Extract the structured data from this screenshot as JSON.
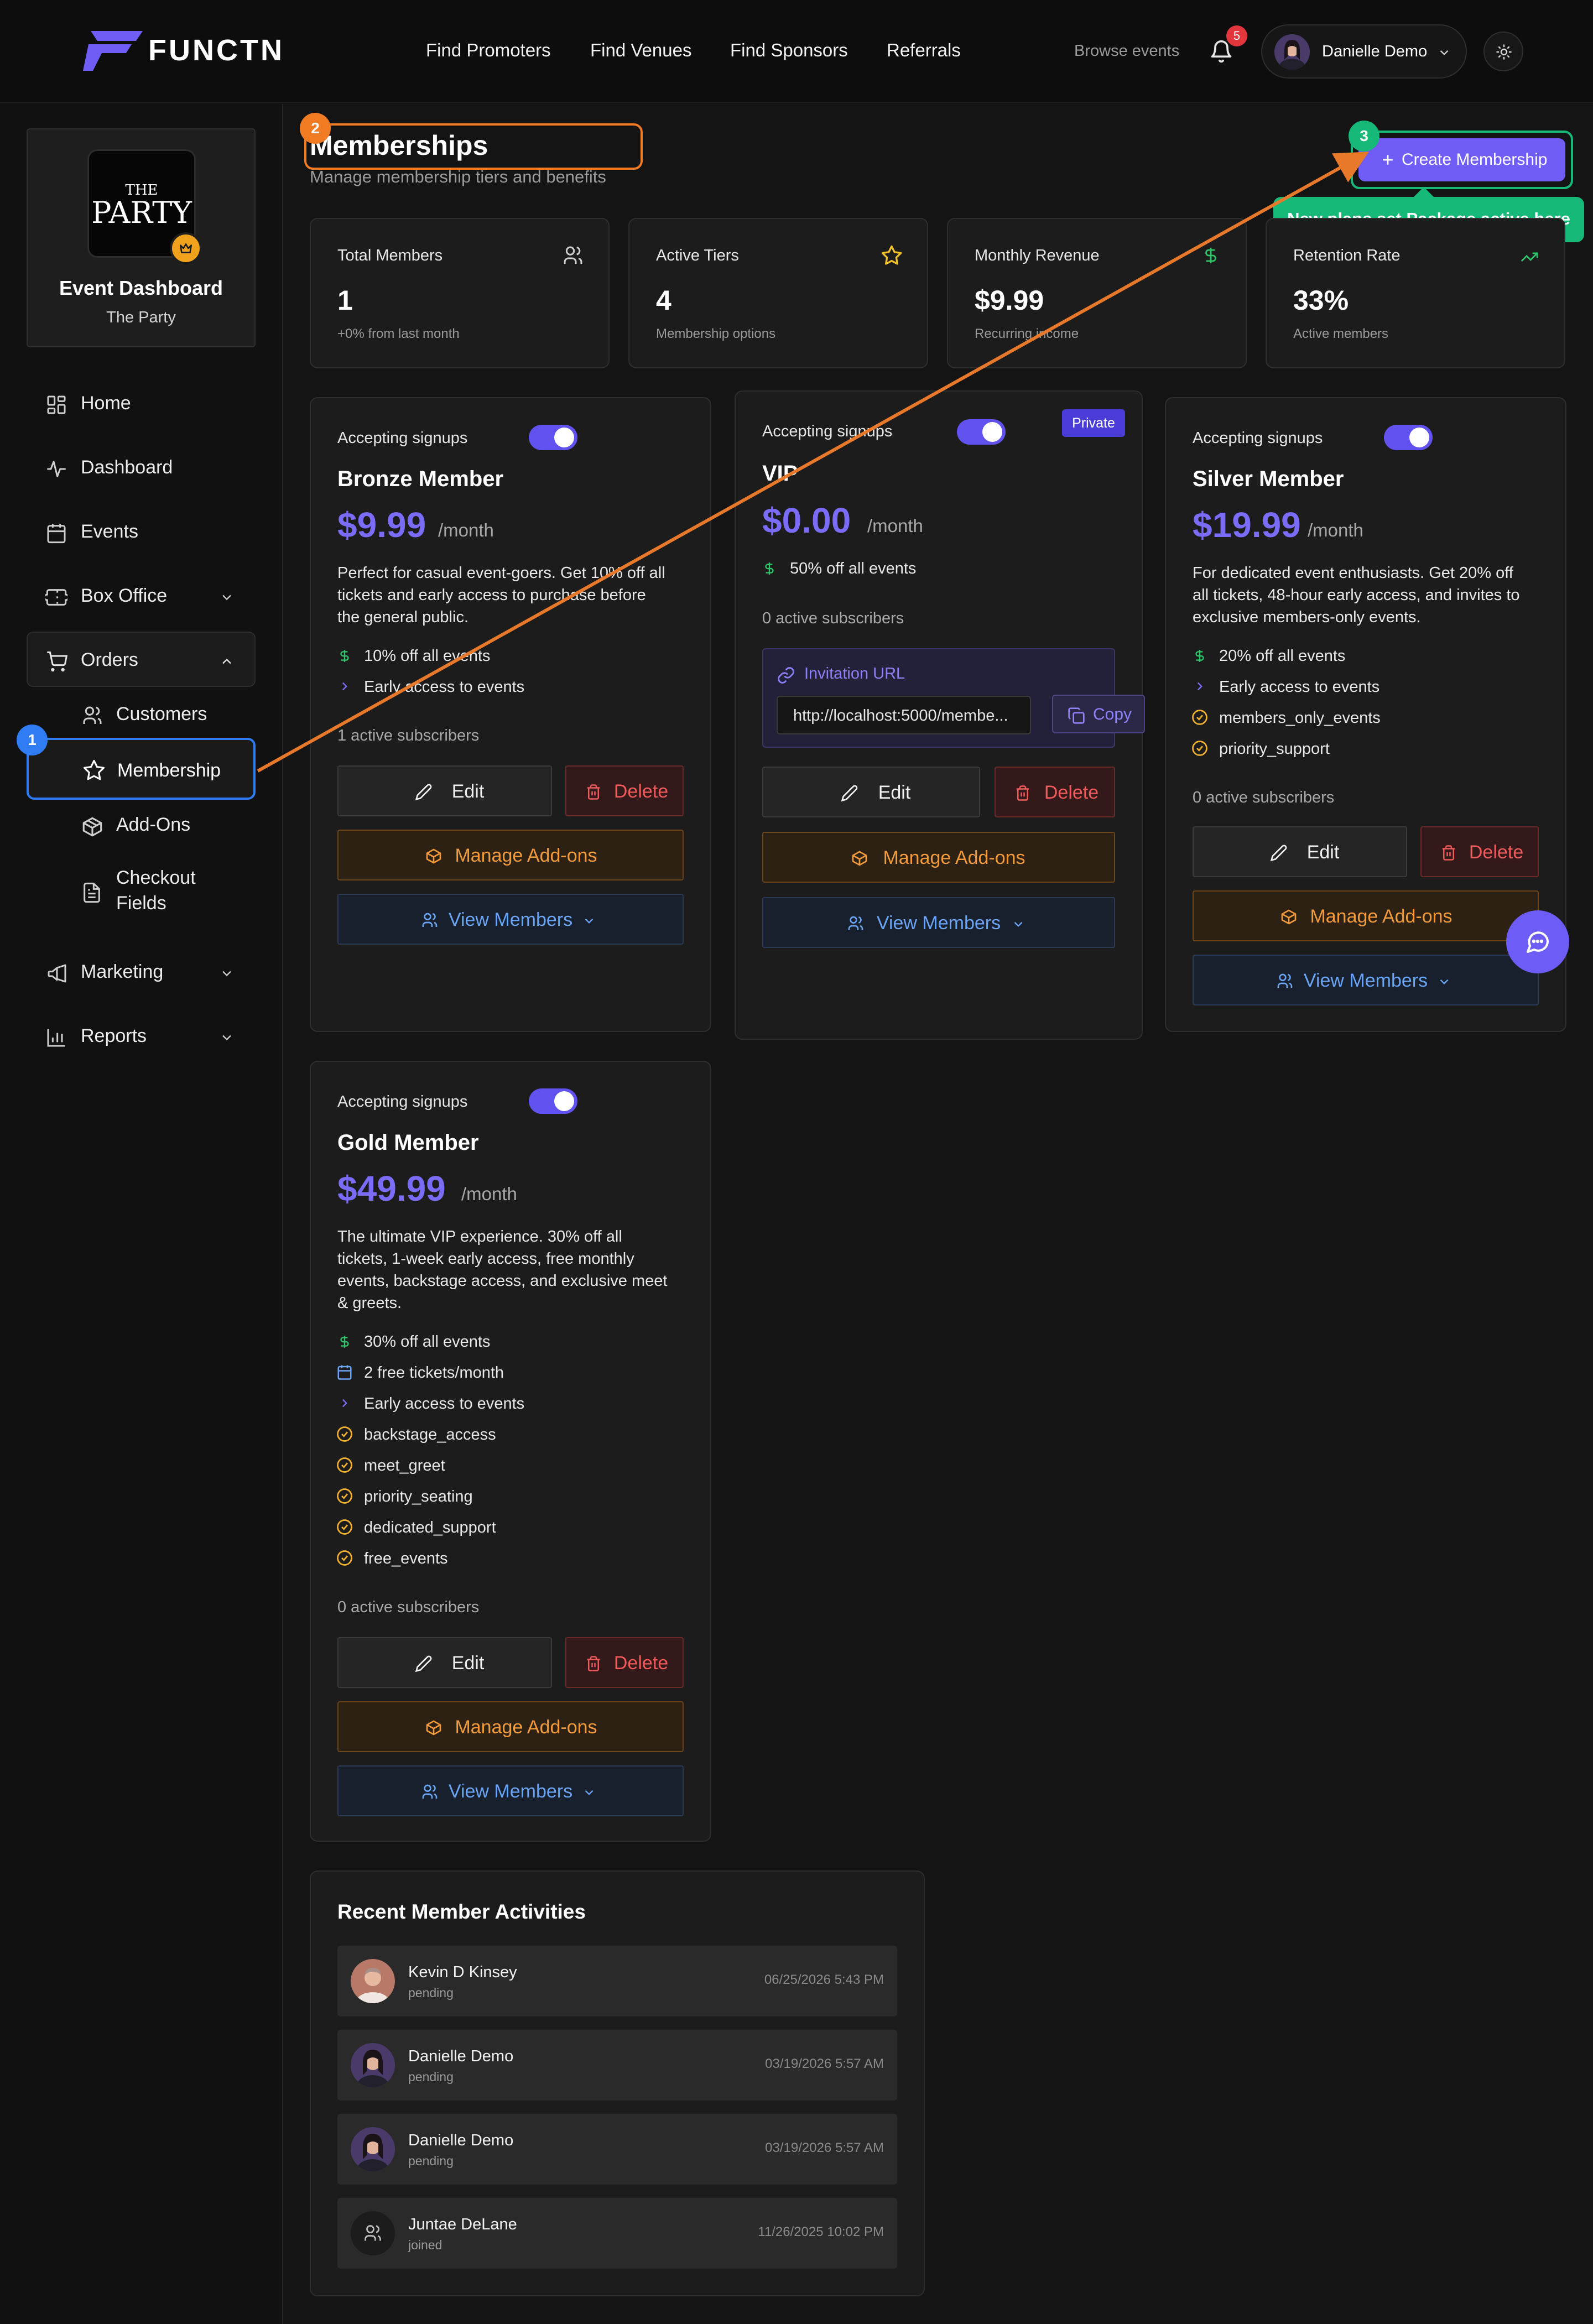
{
  "header": {
    "brand": "FUNCTN",
    "nav": [
      "Find Promoters",
      "Find Venues",
      "Find Sponsors",
      "Referrals"
    ],
    "browse": "Browse events",
    "notification_count": "5",
    "user_name": "Danielle Demo"
  },
  "sidebar": {
    "event_logo_line1": "THE",
    "event_logo_line2": "PARTY",
    "event_title": "Event Dashboard",
    "event_subtitle": "The Party",
    "items": {
      "home": "Home",
      "dashboard": "Dashboard",
      "events": "Events",
      "box_office": "Box Office",
      "orders": "Orders",
      "customers": "Customers",
      "membership": "Membership",
      "addons": "Add-Ons",
      "checkout_line1": "Checkout",
      "checkout_line2": "Fields",
      "marketing": "Marketing",
      "reports": "Reports"
    }
  },
  "annotations": {
    "step1": "1",
    "step2": "2",
    "step3": "3",
    "tooltip": "New plans set Package active here"
  },
  "page": {
    "title": "Memberships",
    "subtitle": "Manage membership tiers and benefits",
    "create_button": "Create Membership"
  },
  "stats": [
    {
      "label": "Total Members",
      "value": "1",
      "sub": "+0% from last month"
    },
    {
      "label": "Active Tiers",
      "value": "4",
      "sub": "Membership options"
    },
    {
      "label": "Monthly Revenue",
      "value": "$9.99",
      "sub": "Recurring income"
    },
    {
      "label": "Retention Rate",
      "value": "33%",
      "sub": "Active members"
    }
  ],
  "common": {
    "accepting": "Accepting signups",
    "per_month": "/month",
    "edit": "Edit",
    "delete": "Delete",
    "manage_addons": "Manage Add-ons",
    "view_members": "View Members",
    "private": "Private",
    "invitation_url": "Invitation URL",
    "copy": "Copy"
  },
  "tiers": {
    "bronze": {
      "name": "Bronze Member",
      "price": "$9.99",
      "desc": [
        "Perfect for casual event-goers. Get 10% off all",
        "tickets and early access to purchase before",
        "the general public."
      ],
      "features": [
        "10% off all events",
        "Early access to events"
      ],
      "subscribers": "1 active subscribers"
    },
    "vip": {
      "name": "VIP",
      "price": "$0.00",
      "features": [
        "50% off all events"
      ],
      "subscribers": "0 active subscribers",
      "invite_url": "http://localhost:5000/membe..."
    },
    "silver": {
      "name": "Silver Member",
      "price": "$19.99",
      "desc": [
        "For dedicated event enthusiasts. Get 20% off",
        "all tickets, 48-hour early access, and invites to",
        "exclusive members-only events."
      ],
      "features": [
        "20% off all events",
        "Early access to events",
        "members_only_events",
        "priority_support"
      ],
      "subscribers": "0 active subscribers"
    },
    "gold": {
      "name": "Gold Member",
      "price": "$49.99",
      "desc": [
        "The ultimate VIP experience. 30% off all",
        "tickets, 1-week early access, free monthly",
        "events, backstage access, and exclusive meet",
        "& greets."
      ],
      "features": [
        "30% off all events",
        "2 free tickets/month",
        "Early access to events",
        "backstage_access",
        "meet_greet",
        "priority_seating",
        "dedicated_support",
        "free_events"
      ],
      "subscribers": "0 active subscribers"
    }
  },
  "activities": {
    "title": "Recent Member Activities",
    "rows": [
      {
        "name": "Kevin D Kinsey",
        "status": "pending",
        "date": "06/25/2026 5:43 PM"
      },
      {
        "name": "Danielle Demo",
        "status": "pending",
        "date": "03/19/2026 5:57 AM"
      },
      {
        "name": "Danielle Demo",
        "status": "pending",
        "date": "03/19/2026 5:57 AM"
      },
      {
        "name": "Juntae DeLane",
        "status": "joined",
        "date": "11/26/2025 10:02 PM"
      }
    ]
  },
  "colors": {
    "accent": "#6f5df5",
    "annotation_orange": "#f07b23",
    "annotation_green": "#17b978",
    "annotation_blue": "#2f7cf5"
  }
}
